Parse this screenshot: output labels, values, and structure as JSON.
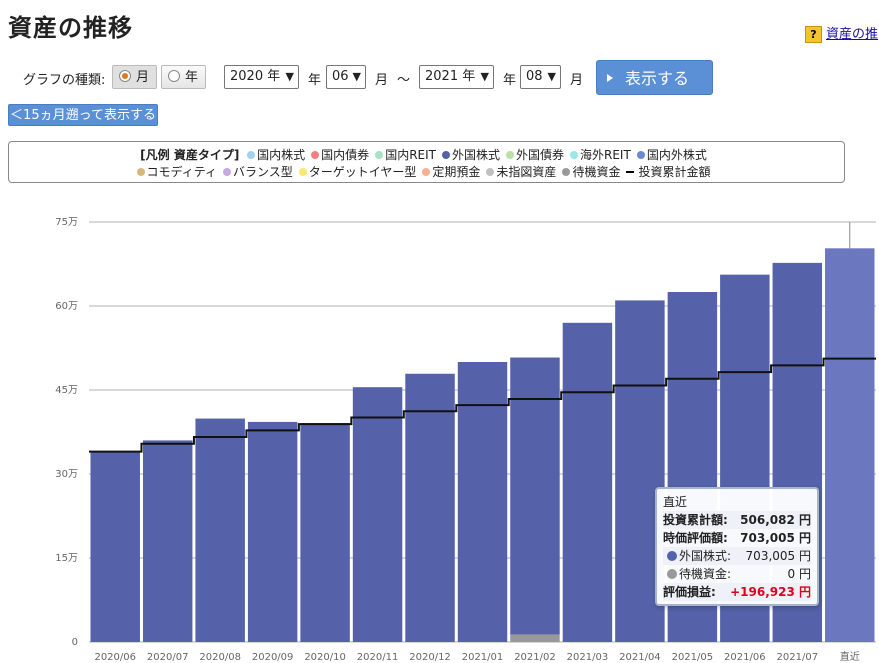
{
  "page": {
    "title": "資産の推移",
    "help_link": "資産の推"
  },
  "controls": {
    "graph_type_label": "グラフの種類:",
    "radio_month": "月",
    "radio_year": "年",
    "selected_radio": "月",
    "start_year": "2020 年",
    "start_year_unit": "年",
    "start_month": "06",
    "start_month_unit": "月",
    "range_sep": "～",
    "end_year": "2021 年",
    "end_year_unit": "年",
    "end_month": "08",
    "end_month_unit": "月",
    "show_button": "表示する",
    "back_button": "＜15ヵ月遡って表示する"
  },
  "legend": {
    "header": "[凡例 資産タイプ]",
    "row1": [
      {
        "label": "国内株式",
        "color": "#9fd2f0"
      },
      {
        "label": "国内債券",
        "color": "#f08080"
      },
      {
        "label": "国内REIT",
        "color": "#a8e0c8"
      },
      {
        "label": "外国株式",
        "color": "#5561a8"
      },
      {
        "label": "外国債券",
        "color": "#b8e0a8"
      },
      {
        "label": "海外REIT",
        "color": "#98e8e8"
      },
      {
        "label": "国内外株式",
        "color": "#6a8ad8"
      }
    ],
    "row2": [
      {
        "label": "コモディティ",
        "color": "#d8b878"
      },
      {
        "label": "バランス型",
        "color": "#c8a8e0"
      },
      {
        "label": "ターゲットイヤー型",
        "color": "#f8e870"
      },
      {
        "label": "定期預金",
        "color": "#f8b090"
      },
      {
        "label": "未指図資産",
        "color": "#c0c0c0"
      },
      {
        "label": "待機資金",
        "color": "#999999"
      }
    ],
    "line_label": "投資累計金額"
  },
  "chart_data": {
    "type": "bar",
    "categories": [
      "2020/06",
      "2020/07",
      "2020/08",
      "2020/09",
      "2020/10",
      "2020/11",
      "2020/12",
      "2021/01",
      "2021/02",
      "2021/03",
      "2021/04",
      "2021/05",
      "2021/06",
      "2021/07",
      "直近"
    ],
    "series": [
      {
        "name": "外国株式",
        "color": "#5561a8",
        "last_color": "#6b78c0",
        "values": [
          340000,
          360000,
          399000,
          393000,
          391000,
          455000,
          479000,
          500000,
          508000,
          570000,
          610000,
          625000,
          656000,
          677000,
          703005
        ]
      },
      {
        "name": "待機資金",
        "color": "#999999",
        "values": [
          0,
          0,
          0,
          0,
          0,
          0,
          0,
          0,
          13000,
          0,
          0,
          0,
          0,
          0,
          0
        ]
      }
    ],
    "line": {
      "name": "投資累計金額",
      "values": [
        340000,
        354000,
        366000,
        378000,
        389000,
        401000,
        412000,
        423000,
        434000,
        446000,
        458000,
        470000,
        482000,
        494000,
        506082
      ]
    },
    "yticks": [
      0,
      150000,
      300000,
      450000,
      600000,
      750000
    ],
    "ytick_labels": [
      "0",
      "15万",
      "30万",
      "45万",
      "60万",
      "75万"
    ],
    "ylim": [
      0,
      750000
    ],
    "grid": true
  },
  "tooltip": {
    "title": "直近",
    "invest_label": "投資累計額:",
    "invest_value": "506,082 円",
    "market_label": "時価評価額:",
    "market_value": "703,005 円",
    "foreign_label": "外国株式:",
    "foreign_value": "703,005 円",
    "foreign_color": "#5561a8",
    "cash_label": "待機資金:",
    "cash_value": "0 円",
    "cash_color": "#999999",
    "gain_label": "評価損益:",
    "gain_value": "+196,923 円"
  }
}
